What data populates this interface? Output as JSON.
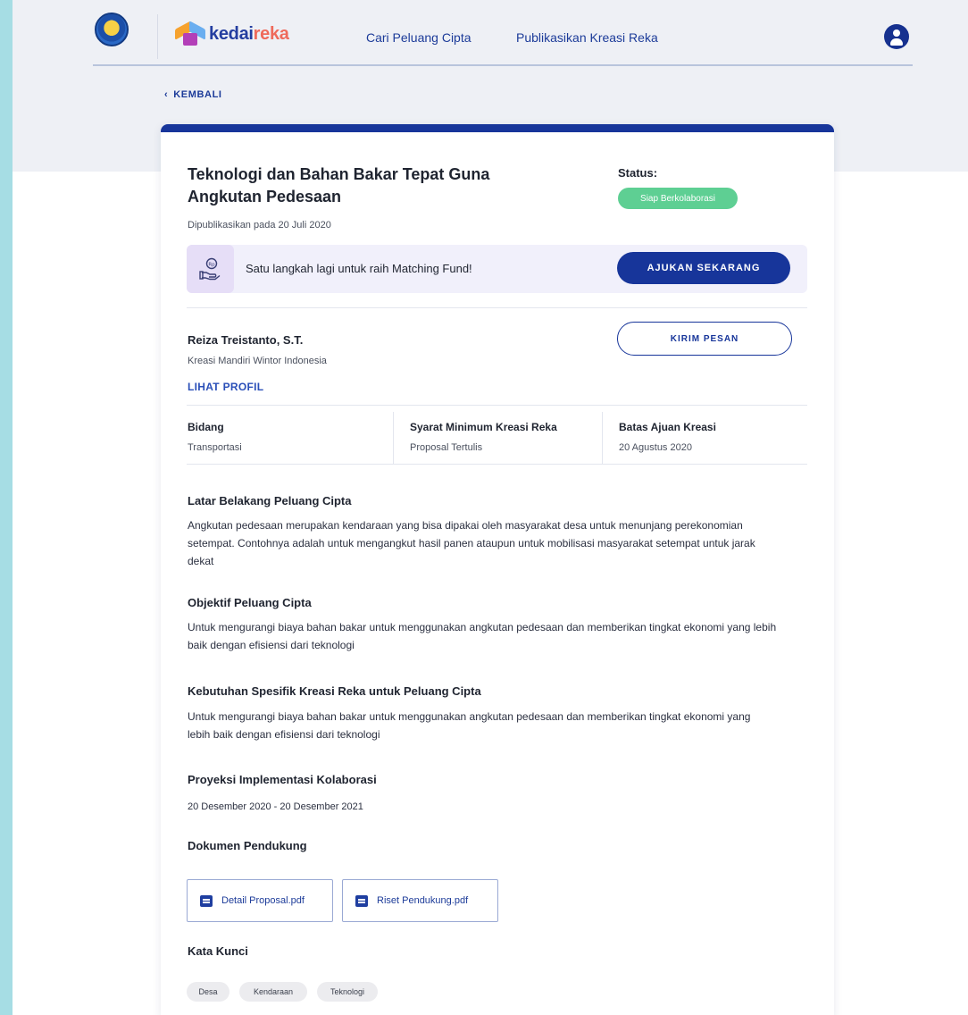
{
  "nav": {
    "brand_part1": "kedai",
    "brand_part2": "reka",
    "links": [
      "Cari Peluang Cipta",
      "Publikasikan Kreasi Reka"
    ]
  },
  "back_label": "KEMBALI",
  "opportunity": {
    "title": "Teknologi dan Bahan Bakar Tepat Guna Angkutan Pedesaan",
    "published": "Dipublikasikan pada 20 Juli 2020",
    "status_label": "Status:",
    "status_value": "Siap Berkolaborasi"
  },
  "promo": {
    "text": "Satu langkah lagi untuk raih Matching Fund!",
    "button": "AJUKAN SEKARANG"
  },
  "owner": {
    "name": "Reiza Treistanto, S.T.",
    "org": "Kreasi Mandiri Wintor Indonesia",
    "profile_link": "LIHAT PROFIL",
    "message_button": "KIRIM PESAN"
  },
  "info": [
    {
      "label": "Bidang",
      "value": "Transportasi"
    },
    {
      "label": "Syarat Minimum Kreasi Reka",
      "value": "Proposal Tertulis"
    },
    {
      "label": "Batas Ajuan Kreasi",
      "value": "20 Agustus 2020"
    }
  ],
  "sections": {
    "background": {
      "title": "Latar Belakang Peluang Cipta",
      "body": "Angkutan pedesaan merupakan kendaraan yang bisa dipakai oleh masyarakat desa untuk menunjang perekonomian setempat. Contohnya adalah untuk mengangkut hasil panen ataupun untuk mobilisasi masyarakat setempat untuk jarak dekat"
    },
    "objective": {
      "title": "Objektif Peluang Cipta",
      "body": "Untuk mengurangi biaya bahan bakar untuk menggunakan angkutan pedesaan dan memberikan tingkat ekonomi yang lebih baik dengan efisiensi dari teknologi"
    },
    "needs": {
      "title": "Kebutuhan Spesifik Kreasi Reka untuk Peluang Cipta",
      "body": "Untuk mengurangi biaya bahan bakar untuk menggunakan angkutan pedesaan dan memberikan tingkat ekonomi yang lebih baik dengan efisiensi dari teknologi"
    },
    "projection": {
      "title": "Proyeksi Implementasi Kolaborasi",
      "body": "20 Desember 2020 - 20 Desember 2021"
    },
    "documents": {
      "title": "Dokumen Pendukung",
      "files": [
        "Detail Proposal.pdf",
        "Riset Pendukung.pdf"
      ]
    },
    "keywords": {
      "title": "Kata Kunci",
      "tags": [
        "Desa",
        "Kendaraan",
        "Teknologi"
      ]
    }
  },
  "colors": {
    "primary": "#17359a",
    "status_green": "#5ecf93",
    "background_teal": "#a6dde4"
  }
}
